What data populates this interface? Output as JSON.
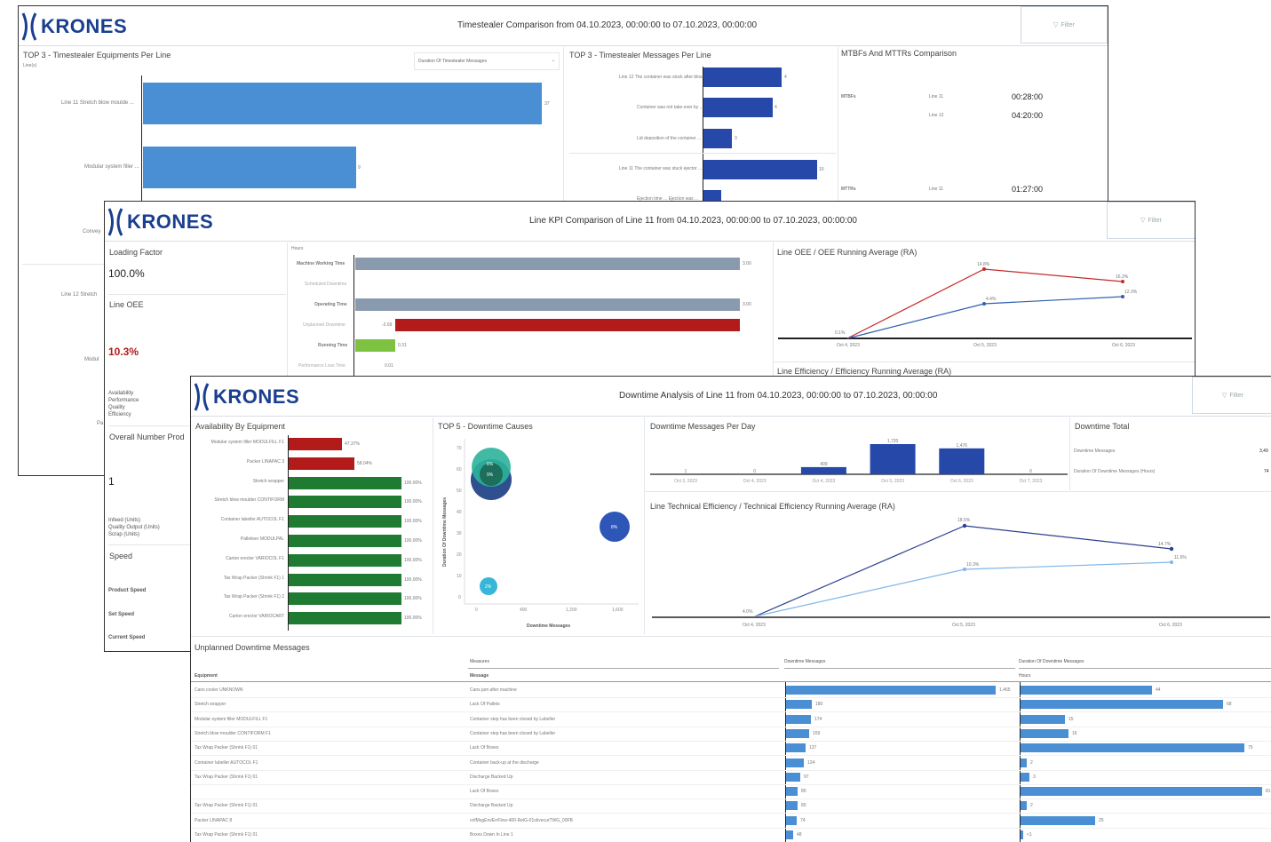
{
  "colors": {
    "brand": "#1a3f8f",
    "bar_blue": "#4a8fd4",
    "dark_blue": "#2648a8",
    "gray_bar": "#8a9aae",
    "red": "#b31b1b",
    "green": "#1f7a32",
    "lime": "#7ec242",
    "light_blue_line": "#7fb6e8"
  },
  "panel1": {
    "logo": "KRONES",
    "title": "Timestealer Comparison from 04.10.2023, 00:00:00 to 07.10.2023, 00:00:00",
    "filter_label": "Filter",
    "equip_title": "TOP 3 - Timestealer Equipments Per Line",
    "equip_dropdown": "Duration Of Timestealer Messages",
    "equip_rows": [
      {
        "label": "Line 11   Stretch blow moulde ...",
        "value": "37"
      },
      {
        "label": "Modular system filler ...",
        "value": "9"
      }
    ],
    "side_labels": {
      "conveyor": "Convey",
      "line12": "Line 12   Stretch",
      "modular": "Modul",
      "pa": "Pa"
    },
    "messages_title": "TOP 3 - Timestealer Messages Per Line",
    "messages_rows": [
      {
        "label": "Line 12   The container was stuck after blow...",
        "value": "4"
      },
      {
        "label": "Container was not take-over by ...",
        "value": "4"
      },
      {
        "label": "Lid deposition of the container ...",
        "value": "3"
      },
      {
        "label": "Line 11   The container was stuck ejector ...",
        "value": "10"
      },
      {
        "label": "Ejection time ... Ejection was ...",
        "value": ""
      }
    ],
    "mtbf_title": "MTBFs And MTTRs Comparison",
    "mtbf_rows": [
      {
        "kind": "MTBFs",
        "line": "Line 11",
        "value": "00:28:00"
      },
      {
        "kind": "",
        "line": "Line 12",
        "value": "04:20:00"
      },
      {
        "kind": "MTTRs",
        "line": "Line 11",
        "value": "01:27:00"
      }
    ]
  },
  "panel2": {
    "logo": "KRONES",
    "title": "Line KPI Comparison of Line 11 from 04.10.2023, 00:00:00 to 07.10.2023, 00:00:00",
    "filter_label": "Filter",
    "loading_factor_label": "Loading Factor",
    "loading_factor_value": "100.0%",
    "line_oee_label": "Line OEE",
    "line_oee_value": "10.3%",
    "oee_breakdown": [
      "Availability",
      "Performance",
      "Quality",
      "Efficiency"
    ],
    "overall_number_label": "Overall Number Prod",
    "overall_number_value": "1",
    "production_units": [
      "Infeed (Units)",
      "Quality Output (Units)",
      "Scrap (Units)"
    ],
    "speed_label": "Speed",
    "speed_items": [
      "Product Speed",
      "Set Speed",
      "Current Speed"
    ],
    "hours_label": "Hours",
    "time_bars": [
      {
        "label": "Machine Working Time",
        "value": "3.00"
      },
      {
        "label": "Scheduled Downtime",
        "value": ""
      },
      {
        "label": "Operating Time",
        "value": "3.00"
      },
      {
        "label": "Unplanned Downtime",
        "value": "-2.69"
      },
      {
        "label": "Running Time",
        "value": "0.31"
      },
      {
        "label": "Performance Loss Time",
        "value": "0.01"
      }
    ],
    "oee_chart_title": "Line OEE / OEE Running Average (RA)",
    "eff_chart_title": "Line Efficiency / Efficiency Running Average (RA)"
  },
  "panel3": {
    "logo": "KRONES",
    "title": "Downtime Analysis of Line 11 from 04.10.2023, 00:00:00 to 07.10.2023, 00:00:00",
    "filter_label": "Filter",
    "availability_title": "Availability By Equipment",
    "availability_rows": [
      {
        "label": "Modular system filler MODULFILL F1",
        "value": "47.37%"
      },
      {
        "label": "Packer LINAPAC 3",
        "value": "58.04%"
      },
      {
        "label": "Stretch wrapper",
        "value": "100.00%"
      },
      {
        "label": "Stretch blow moulder CONTIFORM",
        "value": "100.00%"
      },
      {
        "label": "Container labeller AUTOCOL F1",
        "value": "100.00%"
      },
      {
        "label": "Palletiser MODULPAL",
        "value": "100.00%"
      },
      {
        "label": "Carton erecter VARIOCOL F1",
        "value": "100.00%"
      },
      {
        "label": "Tax Wrap Packer (Shrink F1) 1",
        "value": "100.00%"
      },
      {
        "label": "Tax Wrap Packer (Shrink F1) 2",
        "value": "100.00%"
      },
      {
        "label": "Carton erector VARIOCART",
        "value": "100.00%"
      }
    ],
    "causes_title": "TOP 5 - Downtime Causes",
    "causes_ylabel": "Duration Of Downtime Messages",
    "causes_xlabel": "Downtime Messages",
    "causes_xticks": [
      "0",
      "400",
      "1,200",
      "1,600"
    ],
    "causes_yticks": [
      "70",
      "60",
      "50",
      "40",
      "30",
      "20",
      "10",
      "0"
    ],
    "bubbles": [
      {
        "label": "8%",
        "color": "#2bb39a"
      },
      {
        "label": "9%",
        "color": "#1f4f8f"
      },
      {
        "label": "8%",
        "color": "#2d56b8"
      },
      {
        "label": "2%",
        "color": "#36b6d8"
      }
    ],
    "per_day_title": "Downtime Messages Per Day",
    "per_day": {
      "categories": [
        "Oct 3, 2023",
        "Oct 4, 2023",
        "Oct 4, 2023",
        "Oct 5, 2023",
        "Oct 6, 2023",
        "Oct 7, 2023"
      ],
      "values": [
        1,
        0,
        409,
        1720,
        1476,
        0
      ],
      "labels": [
        "1",
        "0",
        "409",
        "1,720",
        "1,476",
        "0"
      ]
    },
    "total_title": "Downtime Total",
    "total_rows": [
      {
        "label": "Downtime Messages",
        "value": "3,49"
      },
      {
        "label": "Duration Of Downtime Messages (Hours)",
        "value": "74"
      }
    ],
    "tech_eff_title": "Line Technical Efficiency / Technical Efficiency Running Average (RA)",
    "tech_eff_xticks": [
      "Oct 4, 2023",
      "Oct 5, 2023",
      "Oct 6, 2023"
    ],
    "tech_eff_labels": [
      "4.0%",
      "18.5%",
      "14.7%",
      "10.3%",
      "11.6%"
    ],
    "table_title": "Unplanned Downtime Messages",
    "table_header_measures": "Measures",
    "table_header_equipment": "Equipment",
    "table_header_message": "Message",
    "table_header_count": "Downtime Messages",
    "table_header_duration": "Duration Of Downtime Messages",
    "table_header_hours": "Hours",
    "table_rows": [
      {
        "equipment": "Cans cooler UNKNOWN",
        "message": "Cans jam after machine",
        "count": "1,465",
        "count_v": 1465,
        "dur": "44",
        "dur_v": 44
      },
      {
        "equipment": "Stretch wrapper",
        "message": "Lack Of Pallets",
        "count": "180",
        "count_v": 180,
        "dur": "68",
        "dur_v": 68
      },
      {
        "equipment": "Modular system filler MODULFILL F1",
        "message": "Container step has been closed by Labeller",
        "count": "174",
        "count_v": 174,
        "dur": "15",
        "dur_v": 15
      },
      {
        "equipment": "Stretch blow moulder CONTIFORM F1",
        "message": "Container step has been closed by Labeller",
        "count": "159",
        "count_v": 159,
        "dur": "16",
        "dur_v": 16
      },
      {
        "equipment": "Tax Wrap Packer (Shrink F1) 01",
        "message": "Lack Of Boxes",
        "count": "137",
        "count_v": 137,
        "dur": "75",
        "dur_v": 75
      },
      {
        "equipment": "Container labeller AUTOCOL F1",
        "message": "Container back-up at the discharge",
        "count": "124",
        "count_v": 124,
        "dur": "2",
        "dur_v": 2
      },
      {
        "equipment": "Tax Wrap Packer (Shrink F1) 01",
        "message": "Discharge Backed Up",
        "count": "97",
        "count_v": 97,
        "dur": "3",
        "dur_v": 3
      },
      {
        "equipment": "",
        "message": "Lack Of Boxes",
        "count": "80",
        "count_v": 80,
        "dur": "81",
        "dur_v": 81
      },
      {
        "equipment": "Tax Wrap Packer (Shrink F1) 01",
        "message": "Discharge Backed Up",
        "count": "80",
        "count_v": 80,
        "dur": "2",
        "dur_v": 2
      },
      {
        "equipment": "Packer LINAPAC 8",
        "message": "cnfMsgEnvErrFlow-400-RelG-01olivecurTWG_00FB",
        "count": "74",
        "count_v": 74,
        "dur": "25",
        "dur_v": 25
      },
      {
        "equipment": "Tax Wrap Packer (Shrink F1) 01",
        "message": "Boxes Down In Line 1",
        "count": "48",
        "count_v": 48,
        "dur": "<1",
        "dur_v": 0.5
      }
    ]
  }
}
